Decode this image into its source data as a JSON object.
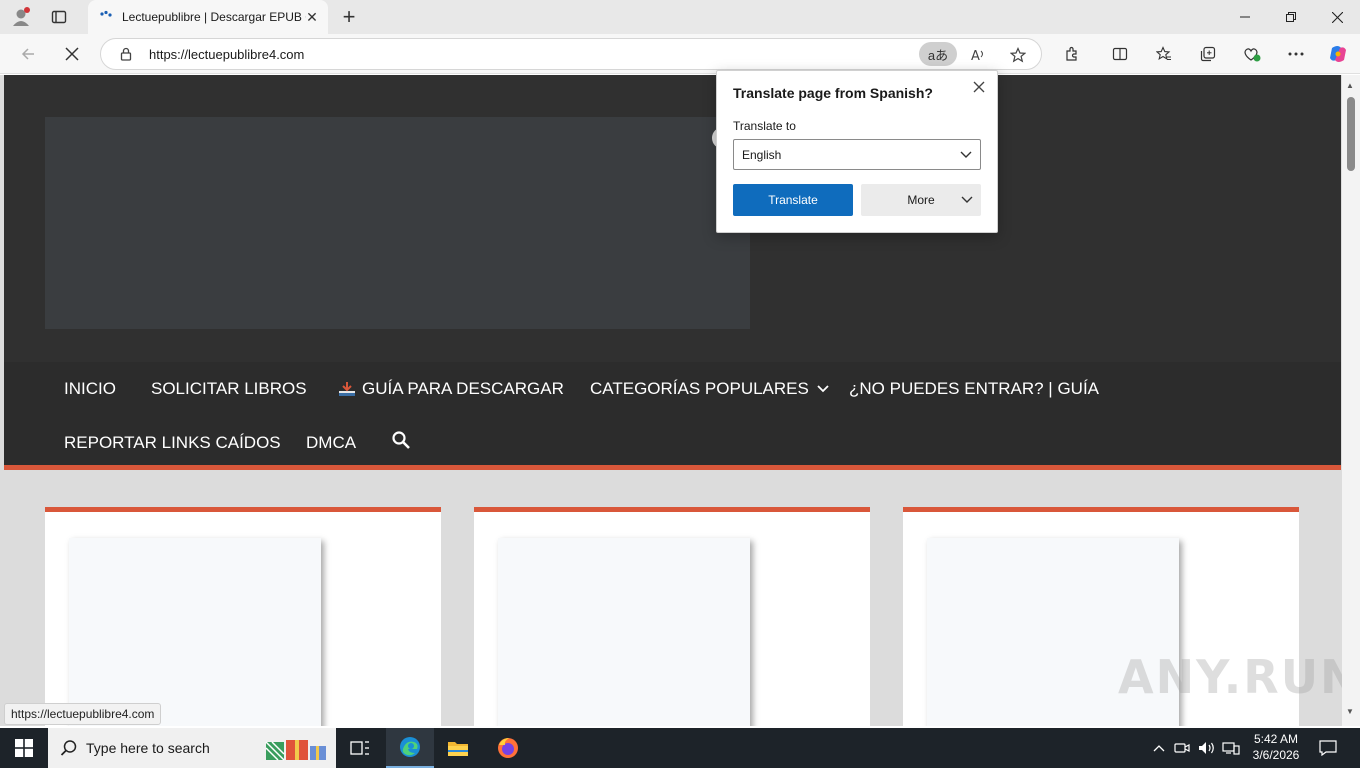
{
  "browser": {
    "tab_title": "Lectuepublibre | Descargar EPUB Gratis",
    "tab_close": "✕",
    "new_tab": "+",
    "url": "https://lectuepublibre4.com",
    "translate_pill": "aあ",
    "status_url": "https://lectuepublibre4.com"
  },
  "site_nav": {
    "items": [
      {
        "label": "INICIO"
      },
      {
        "label": "SOLICITAR LIBROS"
      },
      {
        "label": "GUÍA PARA DESCARGAR"
      },
      {
        "label": "CATEGORÍAS POPULARES"
      },
      {
        "label": "¿NO PUEDES ENTRAR? | GUÍA"
      },
      {
        "label": "REPORTAR LINKS CAÍDOS"
      },
      {
        "label": "DMCA"
      }
    ]
  },
  "translate_popup": {
    "title": "Translate page from Spanish?",
    "label": "Translate to",
    "selected_language": "English",
    "translate_button": "Translate",
    "more_button": "More"
  },
  "watermark": "ANY.RUN",
  "taskbar": {
    "search_placeholder": "Type here to search",
    "time": "5:42 AM",
    "date": "3/6/2026"
  },
  "colors": {
    "accent_orange": "#d9573a",
    "translate_blue": "#0f6cbd",
    "site_header": "#303030"
  }
}
